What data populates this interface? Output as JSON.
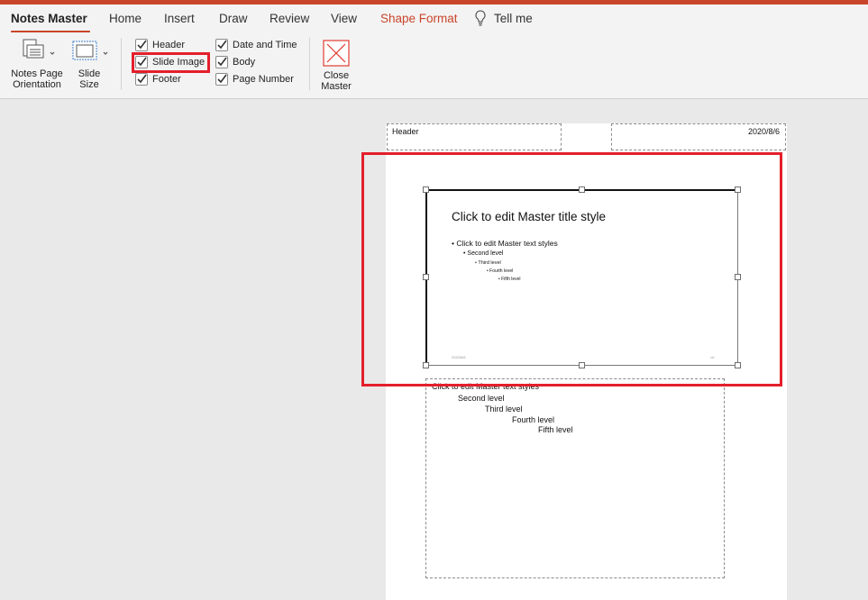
{
  "tabs": [
    {
      "label": "Notes Master"
    },
    {
      "label": "Home"
    },
    {
      "label": "Insert"
    },
    {
      "label": "Draw"
    },
    {
      "label": "Review"
    },
    {
      "label": "View"
    },
    {
      "label": "Shape Format"
    },
    {
      "label": "Tell me"
    }
  ],
  "ribbon": {
    "notes_page_orientation": {
      "line1": "Notes Page",
      "line2": "Orientation"
    },
    "slide_size": {
      "line1": "Slide",
      "line2": "Size"
    },
    "checkboxes": {
      "header": "Header",
      "slide_image": "Slide Image",
      "footer": "Footer",
      "date_time": "Date and Time",
      "body": "Body",
      "page_number": "Page Number"
    },
    "close_master": {
      "line1": "Close",
      "line2": "Master"
    }
  },
  "page": {
    "header_text": "Header",
    "date_text": "2020/8/6",
    "slide": {
      "title": "Click to edit Master title style",
      "levels": [
        "Click to edit Master text styles",
        "Second level",
        "Third level",
        "Fourth level",
        "Fifth level"
      ],
      "footer_date": "2020/8/6",
      "footer_num": "‹#›"
    },
    "notes": {
      "levels": [
        "Click to edit Master text styles",
        "Second level",
        "Third level",
        "Fourth level",
        "Fifth level"
      ]
    }
  },
  "colors": {
    "accent": "#c9452a",
    "highlight": "#e41f2b"
  }
}
